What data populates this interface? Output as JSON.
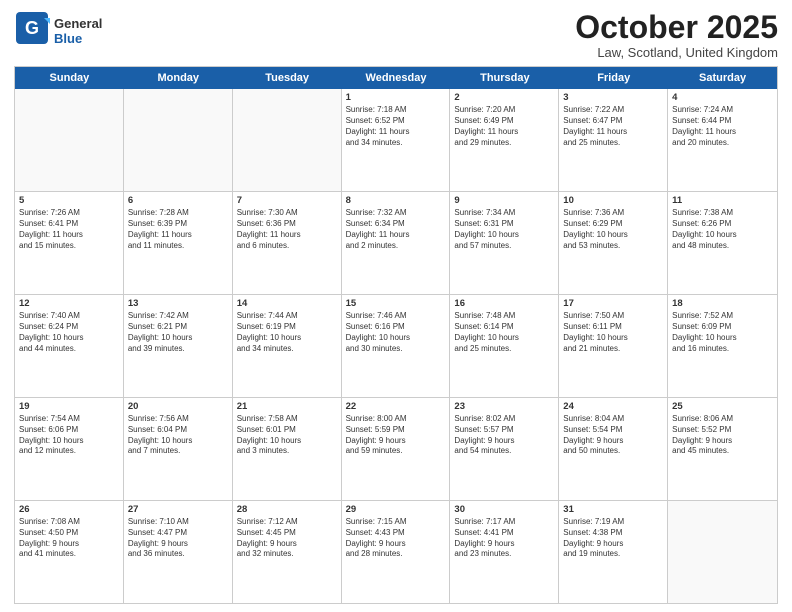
{
  "logo": {
    "general": "General",
    "blue": "Blue"
  },
  "title": "October 2025",
  "location": "Law, Scotland, United Kingdom",
  "days": [
    "Sunday",
    "Monday",
    "Tuesday",
    "Wednesday",
    "Thursday",
    "Friday",
    "Saturday"
  ],
  "rows": [
    [
      {
        "day": "",
        "text": ""
      },
      {
        "day": "",
        "text": ""
      },
      {
        "day": "",
        "text": ""
      },
      {
        "day": "1",
        "text": "Sunrise: 7:18 AM\nSunset: 6:52 PM\nDaylight: 11 hours\nand 34 minutes."
      },
      {
        "day": "2",
        "text": "Sunrise: 7:20 AM\nSunset: 6:49 PM\nDaylight: 11 hours\nand 29 minutes."
      },
      {
        "day": "3",
        "text": "Sunrise: 7:22 AM\nSunset: 6:47 PM\nDaylight: 11 hours\nand 25 minutes."
      },
      {
        "day": "4",
        "text": "Sunrise: 7:24 AM\nSunset: 6:44 PM\nDaylight: 11 hours\nand 20 minutes."
      }
    ],
    [
      {
        "day": "5",
        "text": "Sunrise: 7:26 AM\nSunset: 6:41 PM\nDaylight: 11 hours\nand 15 minutes."
      },
      {
        "day": "6",
        "text": "Sunrise: 7:28 AM\nSunset: 6:39 PM\nDaylight: 11 hours\nand 11 minutes."
      },
      {
        "day": "7",
        "text": "Sunrise: 7:30 AM\nSunset: 6:36 PM\nDaylight: 11 hours\nand 6 minutes."
      },
      {
        "day": "8",
        "text": "Sunrise: 7:32 AM\nSunset: 6:34 PM\nDaylight: 11 hours\nand 2 minutes."
      },
      {
        "day": "9",
        "text": "Sunrise: 7:34 AM\nSunset: 6:31 PM\nDaylight: 10 hours\nand 57 minutes."
      },
      {
        "day": "10",
        "text": "Sunrise: 7:36 AM\nSunset: 6:29 PM\nDaylight: 10 hours\nand 53 minutes."
      },
      {
        "day": "11",
        "text": "Sunrise: 7:38 AM\nSunset: 6:26 PM\nDaylight: 10 hours\nand 48 minutes."
      }
    ],
    [
      {
        "day": "12",
        "text": "Sunrise: 7:40 AM\nSunset: 6:24 PM\nDaylight: 10 hours\nand 44 minutes."
      },
      {
        "day": "13",
        "text": "Sunrise: 7:42 AM\nSunset: 6:21 PM\nDaylight: 10 hours\nand 39 minutes."
      },
      {
        "day": "14",
        "text": "Sunrise: 7:44 AM\nSunset: 6:19 PM\nDaylight: 10 hours\nand 34 minutes."
      },
      {
        "day": "15",
        "text": "Sunrise: 7:46 AM\nSunset: 6:16 PM\nDaylight: 10 hours\nand 30 minutes."
      },
      {
        "day": "16",
        "text": "Sunrise: 7:48 AM\nSunset: 6:14 PM\nDaylight: 10 hours\nand 25 minutes."
      },
      {
        "day": "17",
        "text": "Sunrise: 7:50 AM\nSunset: 6:11 PM\nDaylight: 10 hours\nand 21 minutes."
      },
      {
        "day": "18",
        "text": "Sunrise: 7:52 AM\nSunset: 6:09 PM\nDaylight: 10 hours\nand 16 minutes."
      }
    ],
    [
      {
        "day": "19",
        "text": "Sunrise: 7:54 AM\nSunset: 6:06 PM\nDaylight: 10 hours\nand 12 minutes."
      },
      {
        "day": "20",
        "text": "Sunrise: 7:56 AM\nSunset: 6:04 PM\nDaylight: 10 hours\nand 7 minutes."
      },
      {
        "day": "21",
        "text": "Sunrise: 7:58 AM\nSunset: 6:01 PM\nDaylight: 10 hours\nand 3 minutes."
      },
      {
        "day": "22",
        "text": "Sunrise: 8:00 AM\nSunset: 5:59 PM\nDaylight: 9 hours\nand 59 minutes."
      },
      {
        "day": "23",
        "text": "Sunrise: 8:02 AM\nSunset: 5:57 PM\nDaylight: 9 hours\nand 54 minutes."
      },
      {
        "day": "24",
        "text": "Sunrise: 8:04 AM\nSunset: 5:54 PM\nDaylight: 9 hours\nand 50 minutes."
      },
      {
        "day": "25",
        "text": "Sunrise: 8:06 AM\nSunset: 5:52 PM\nDaylight: 9 hours\nand 45 minutes."
      }
    ],
    [
      {
        "day": "26",
        "text": "Sunrise: 7:08 AM\nSunset: 4:50 PM\nDaylight: 9 hours\nand 41 minutes."
      },
      {
        "day": "27",
        "text": "Sunrise: 7:10 AM\nSunset: 4:47 PM\nDaylight: 9 hours\nand 36 minutes."
      },
      {
        "day": "28",
        "text": "Sunrise: 7:12 AM\nSunset: 4:45 PM\nDaylight: 9 hours\nand 32 minutes."
      },
      {
        "day": "29",
        "text": "Sunrise: 7:15 AM\nSunset: 4:43 PM\nDaylight: 9 hours\nand 28 minutes."
      },
      {
        "day": "30",
        "text": "Sunrise: 7:17 AM\nSunset: 4:41 PM\nDaylight: 9 hours\nand 23 minutes."
      },
      {
        "day": "31",
        "text": "Sunrise: 7:19 AM\nSunset: 4:38 PM\nDaylight: 9 hours\nand 19 minutes."
      },
      {
        "day": "",
        "text": ""
      }
    ]
  ]
}
